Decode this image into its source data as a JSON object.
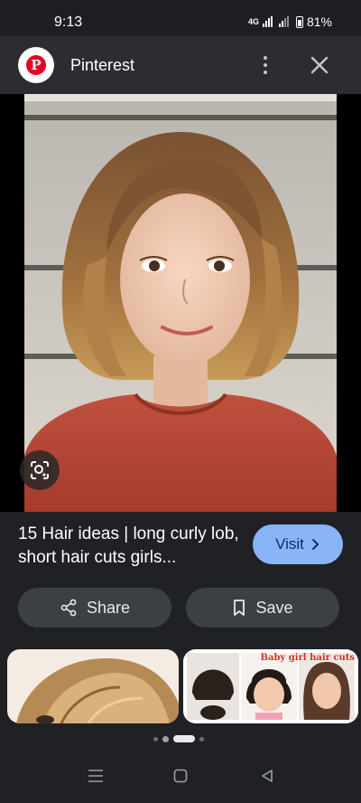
{
  "status_bar": {
    "time": "9:13",
    "network": "4G",
    "battery": "81%"
  },
  "header": {
    "app_name": "Pinterest",
    "logo_letter": "P"
  },
  "pin": {
    "title": "15 Hair ideas | long curly lob, short hair cuts girls..."
  },
  "actions": {
    "visit_label": "Visit",
    "share_label": "Share",
    "save_label": "Save"
  },
  "related": {
    "banner_text": "Baby girl hair cuts"
  },
  "pager": {
    "count": 4,
    "active": 2
  },
  "icons": {
    "more": "more-vertical-icon",
    "close": "close-icon",
    "lens": "lens-search-icon",
    "share": "share-icon",
    "save": "bookmark-icon",
    "visit": "chevron-right-icon"
  }
}
